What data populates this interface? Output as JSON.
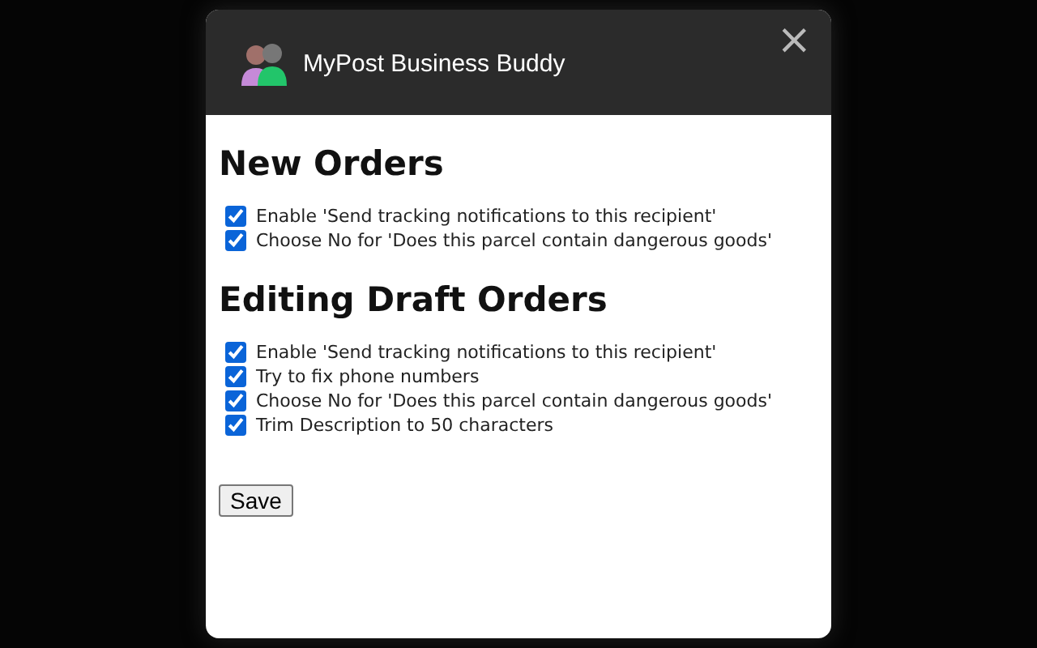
{
  "popup": {
    "title": "MyPost Business Buddy",
    "close": "×"
  },
  "sections": [
    {
      "heading": "New Orders",
      "options": [
        {
          "label": "Enable 'Send tracking notifications to this recipient'",
          "checked": true
        },
        {
          "label": "Choose No for 'Does this parcel contain dangerous goods'",
          "checked": true
        }
      ]
    },
    {
      "heading": "Editing Draft Orders",
      "options": [
        {
          "label": "Enable 'Send tracking notifications to this recipient'",
          "checked": true
        },
        {
          "label": "Try to fix phone numbers",
          "checked": true
        },
        {
          "label": "Choose No for 'Does this parcel contain dangerous goods'",
          "checked": true
        },
        {
          "label": "Trim Description to 50 characters",
          "checked": true
        }
      ]
    }
  ],
  "save_button": "Save"
}
